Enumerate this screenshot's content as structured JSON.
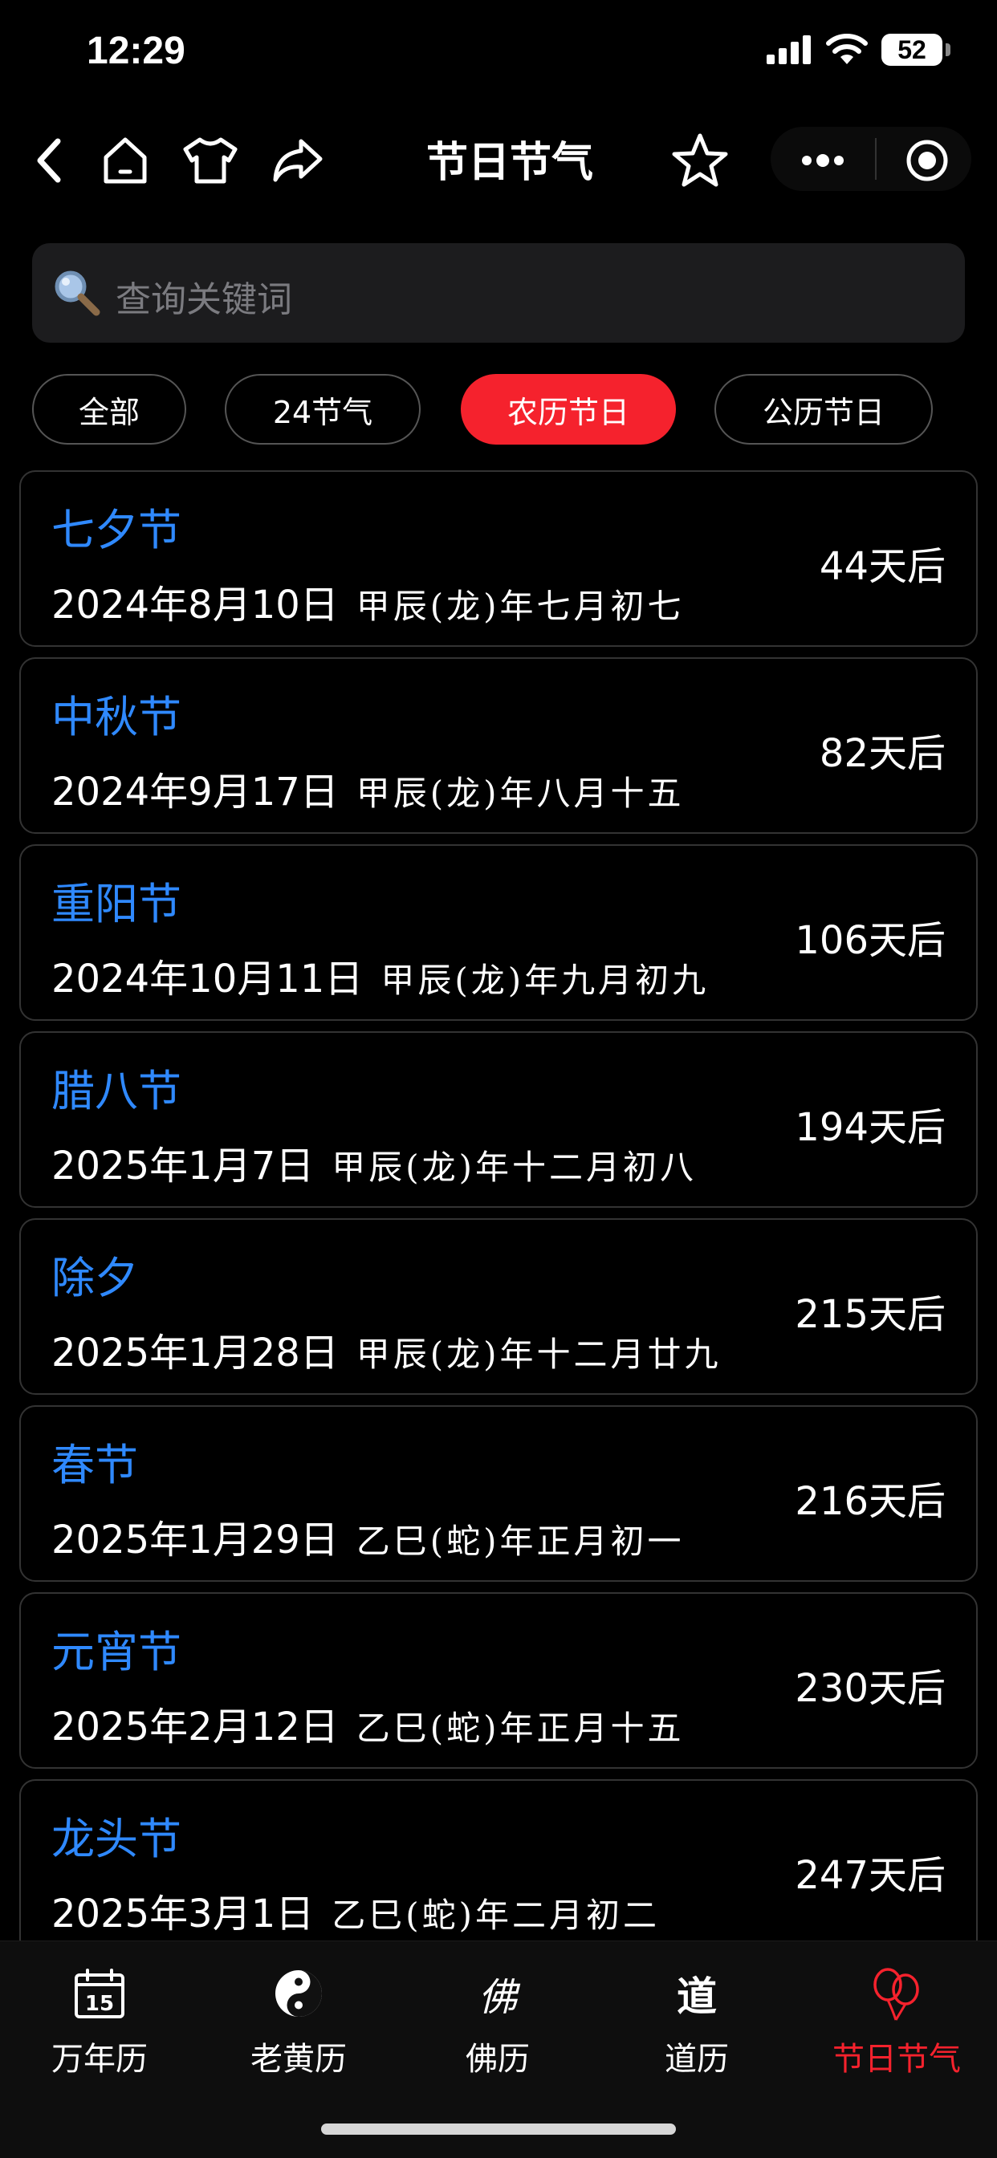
{
  "status": {
    "time": "12:29",
    "battery": "52"
  },
  "nav": {
    "title": "节日节气",
    "icons": [
      "back-icon",
      "home-icon",
      "shirt-icon",
      "share-icon",
      "star-icon",
      "more-icon",
      "target-icon"
    ]
  },
  "search": {
    "placeholder": "查询关键词"
  },
  "filters": [
    {
      "label": "全部",
      "active": false
    },
    {
      "label": "24节气",
      "active": false
    },
    {
      "label": "农历节日",
      "active": true
    },
    {
      "label": "公历节日",
      "active": false
    }
  ],
  "festivals": [
    {
      "name": "七夕节",
      "date": "2024年8月10日",
      "lunar": "甲辰(龙)年七月初七",
      "days": "44天后"
    },
    {
      "name": "中秋节",
      "date": "2024年9月17日",
      "lunar": "甲辰(龙)年八月十五",
      "days": "82天后"
    },
    {
      "name": "重阳节",
      "date": "2024年10月11日",
      "lunar": "甲辰(龙)年九月初九",
      "days": "106天后"
    },
    {
      "name": "腊八节",
      "date": "2025年1月7日",
      "lunar": "甲辰(龙)年十二月初八",
      "days": "194天后"
    },
    {
      "name": "除夕",
      "date": "2025年1月28日",
      "lunar": "甲辰(龙)年十二月廿九",
      "days": "215天后"
    },
    {
      "name": "春节",
      "date": "2025年1月29日",
      "lunar": "乙巳(蛇)年正月初一",
      "days": "216天后"
    },
    {
      "name": "元宵节",
      "date": "2025年2月12日",
      "lunar": "乙巳(蛇)年正月十五",
      "days": "230天后"
    },
    {
      "name": "龙头节",
      "date": "2025年3月1日",
      "lunar": "乙巳(蛇)年二月初二",
      "days": "247天后"
    }
  ],
  "tabs": [
    {
      "label": "万年历",
      "icon": "calendar-icon",
      "day": "15",
      "active": false
    },
    {
      "label": "老黄历",
      "icon": "yin-yang-icon",
      "active": false
    },
    {
      "label": "佛历",
      "icon": "buddha-char-icon",
      "glyph": "佛",
      "active": false
    },
    {
      "label": "道历",
      "icon": "dao-char-icon",
      "glyph": "道",
      "active": false
    },
    {
      "label": "节日节气",
      "icon": "balloons-icon",
      "active": true
    }
  ],
  "colors": {
    "accent": "#f5222d",
    "link": "#2f89ff",
    "background": "#000000",
    "card_border": "#333333"
  }
}
